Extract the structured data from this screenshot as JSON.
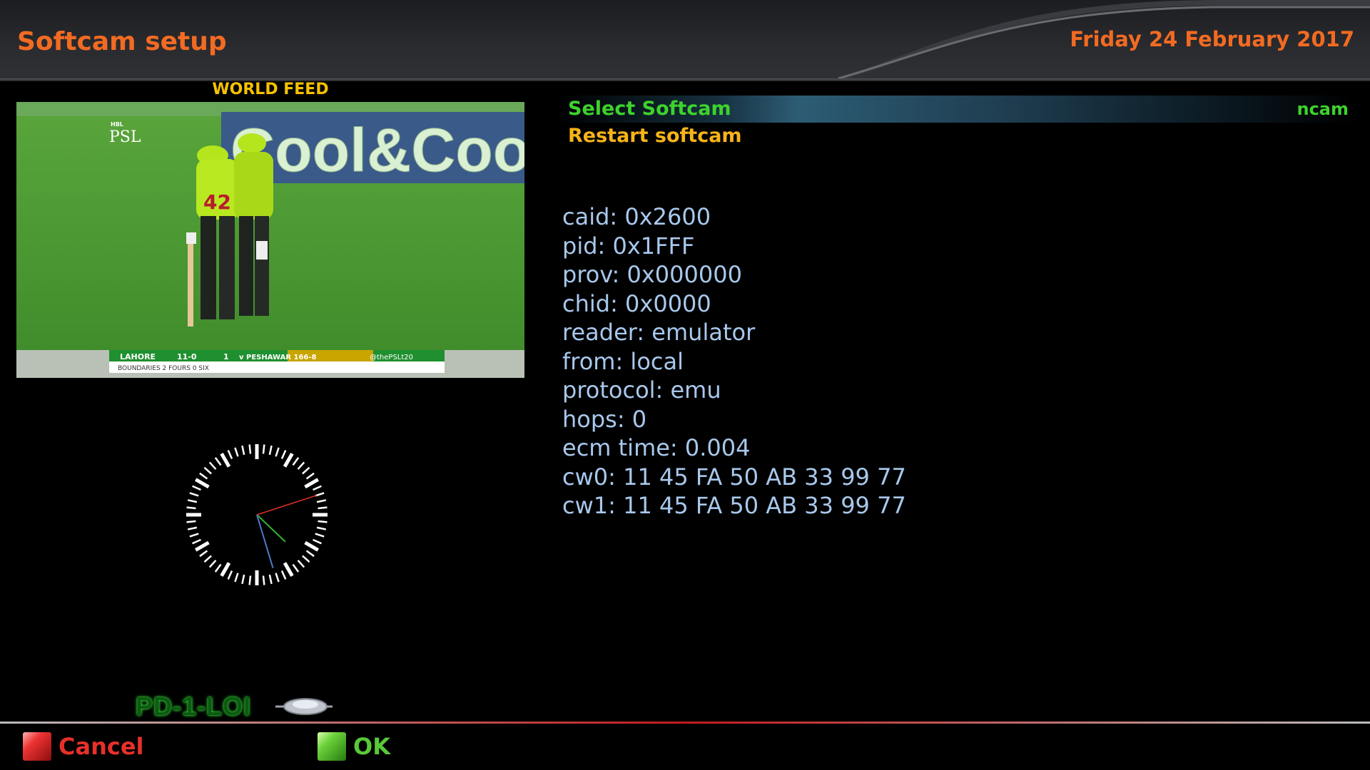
{
  "header": {
    "title": "Softcam setup",
    "date": "Friday 24 February 2017"
  },
  "preview": {
    "label": "WORLD FEED",
    "overlay": {
      "brand_small": "HBL",
      "brand": "PSL",
      "banner": "Cool&Coo",
      "jersey_number": "42",
      "score_team": "LAHORE",
      "score_runs": "11-0",
      "score_overs": "1",
      "score_opponent": "v PESHAWAR 166-8",
      "score_handle": "@thePSLt20",
      "score_stats": "BOUNDARIES   2 FOURS   0 SIX"
    }
  },
  "clock": {
    "hour": 4,
    "minute": 27,
    "second": 12
  },
  "menu": {
    "items": [
      {
        "label": "Select Softcam",
        "value": "ncam",
        "selected": true
      },
      {
        "label": "Restart softcam",
        "value": "",
        "selected": false
      }
    ]
  },
  "info": {
    "lines": [
      "caid: 0x2600",
      "pid: 0x1FFF",
      "prov: 0x000000",
      "chid: 0x0000",
      "reader: emulator",
      "from: local",
      "protocol: emu",
      "hops: 0",
      "ecm time: 0.004",
      "cw0: 11 45 FA 50 AB 33 99 77",
      "cw1: 11 45 FA 50 AB 33 99 77"
    ]
  },
  "logo": {
    "text": "PD-1-LOI",
    "icon": "satellite-icon"
  },
  "footer": {
    "red": {
      "label": "Cancel",
      "color": "#e8302a"
    },
    "green": {
      "label": "OK",
      "color": "#58c93a"
    }
  },
  "colors": {
    "accent_orange": "#f26b22",
    "selected_green": "#3dd22c",
    "menu_yellow": "#f7b418",
    "info_blue": "#a8c8ec",
    "feed_yellow": "#f7c200"
  }
}
